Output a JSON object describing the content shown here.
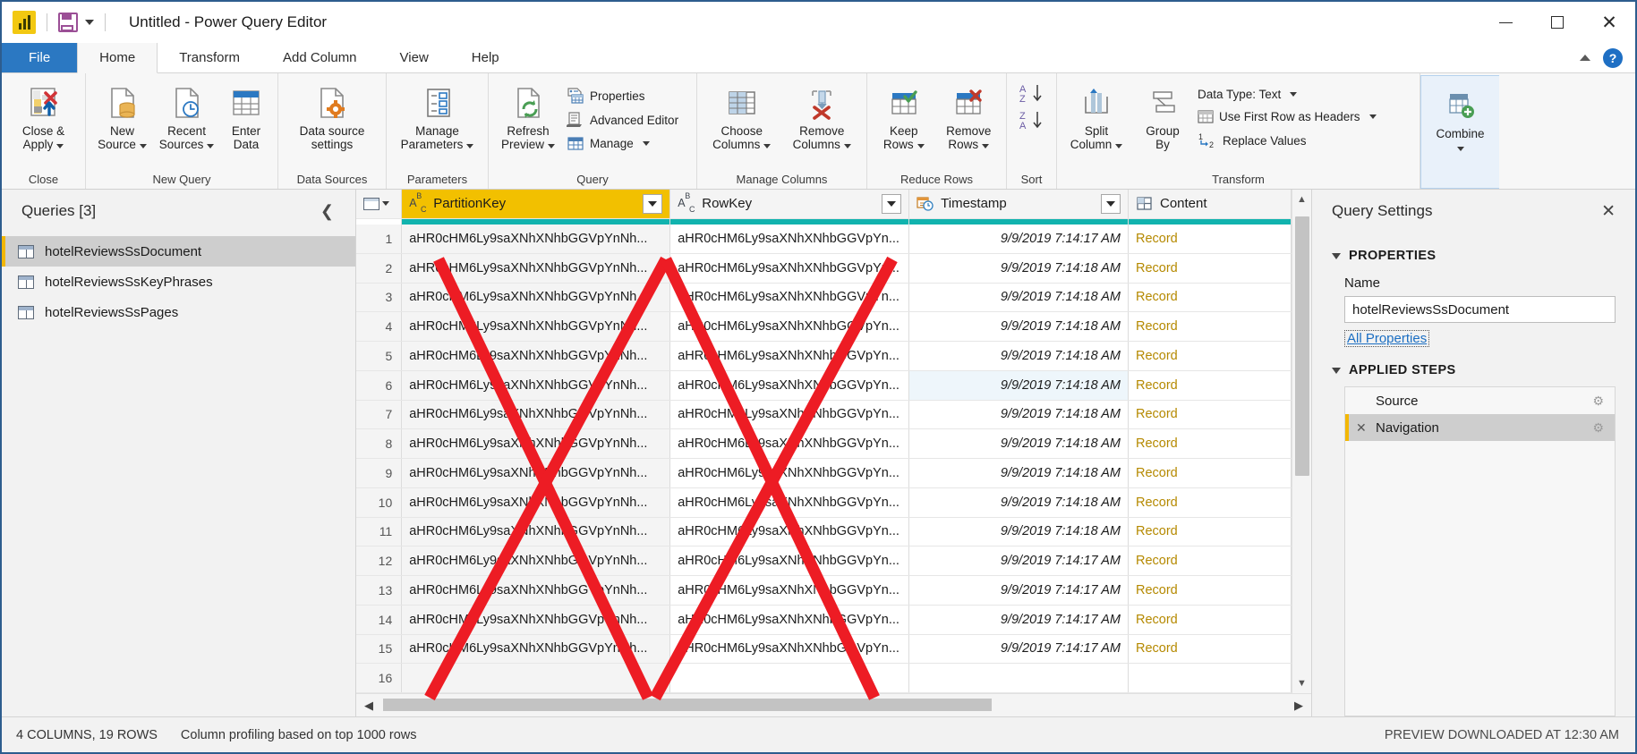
{
  "window": {
    "title": "Untitled - Power Query Editor",
    "logo_icon": "power-bi-logo-icon",
    "save_icon": "save-icon",
    "quick_access_caret": "chevron-down-icon",
    "minimize": "minimize-icon",
    "maximize": "maximize-icon",
    "close": "close-icon"
  },
  "ribbon": {
    "tabs": [
      {
        "label": "File",
        "kind": "file"
      },
      {
        "label": "Home",
        "kind": "active"
      },
      {
        "label": "Transform",
        "kind": "normal"
      },
      {
        "label": "Add Column",
        "kind": "normal"
      },
      {
        "label": "View",
        "kind": "normal"
      },
      {
        "label": "Help",
        "kind": "normal"
      }
    ],
    "collapse_icon": "chevron-up-icon",
    "help_icon": "help-question-icon",
    "help_label": "?",
    "groups": {
      "close": {
        "label": "Close",
        "close_apply_line1": "Close &",
        "close_apply_line2": "Apply"
      },
      "new_query": {
        "label": "New Query",
        "new_source_line1": "New",
        "new_source_line2": "Source",
        "recent_sources_line1": "Recent",
        "recent_sources_line2": "Sources",
        "enter_data_line1": "Enter",
        "enter_data_line2": "Data"
      },
      "data_sources": {
        "label": "Data Sources",
        "data_source_settings_line1": "Data source",
        "data_source_settings_line2": "settings"
      },
      "parameters": {
        "label": "Parameters",
        "manage_parameters_line1": "Manage",
        "manage_parameters_line2": "Parameters"
      },
      "query": {
        "label": "Query",
        "refresh_preview_line1": "Refresh",
        "refresh_preview_line2": "Preview",
        "properties": "Properties",
        "advanced_editor": "Advanced Editor",
        "manage": "Manage"
      },
      "manage_columns": {
        "label": "Manage Columns",
        "choose_columns_line1": "Choose",
        "choose_columns_line2": "Columns",
        "remove_columns_line1": "Remove",
        "remove_columns_line2": "Columns"
      },
      "reduce_rows": {
        "label": "Reduce Rows",
        "keep_rows_line1": "Keep",
        "keep_rows_line2": "Rows",
        "remove_rows_line1": "Remove",
        "remove_rows_line2": "Rows"
      },
      "sort": {
        "label": "Sort",
        "sort_asc_icon": "sort-ascending-icon",
        "sort_desc_icon": "sort-descending-icon"
      },
      "transform": {
        "label": "Transform",
        "split_column_line1": "Split",
        "split_column_line2": "Column",
        "group_by_line1": "Group",
        "group_by_line2": "By",
        "data_type": "Data Type: Text",
        "use_first_row_as_headers": "Use First Row as Headers",
        "replace_values": "Replace Values"
      },
      "combine": {
        "label": "Combine"
      }
    }
  },
  "queries_pane": {
    "title": "Queries [3]",
    "collapse_icon": "chevron-left-icon",
    "items": [
      {
        "label": "hotelReviewsSsDocument",
        "selected": true
      },
      {
        "label": "hotelReviewsSsKeyPhrases",
        "selected": false
      },
      {
        "label": "hotelReviewsSsPages",
        "selected": false
      }
    ]
  },
  "grid": {
    "columns": [
      {
        "name": "PartitionKey",
        "type_icon": "abc-text-icon",
        "highlighted": true,
        "filter_icon": "filter-dropdown-icon"
      },
      {
        "name": "RowKey",
        "type_icon": "abc-text-icon",
        "highlighted": false,
        "filter_icon": "filter-dropdown-icon"
      },
      {
        "name": "Timestamp",
        "type_icon": "datetime-icon",
        "highlighted": false,
        "filter_icon": "filter-dropdown-icon"
      },
      {
        "name": "Content",
        "type_icon": "table-record-icon",
        "highlighted": false,
        "filter_icon": null
      }
    ],
    "select_all_icon": "select-all-table-icon",
    "rows": [
      {
        "n": "1",
        "partitionKey": "aHR0cHM6Ly9saXNhXNhbGGVpYnNh...",
        "rowKey": "aHR0cHM6Ly9saXNhXNhbGGVpYn...",
        "timestamp": "9/9/2019 7:14:17 AM",
        "content": "Record"
      },
      {
        "n": "2",
        "partitionKey": "aHR0cHM6Ly9saXNhXNhbGGVpYnNh...",
        "rowKey": "aHR0cHM6Ly9saXNhXNhbGGVpYn...",
        "timestamp": "9/9/2019 7:14:18 AM",
        "content": "Record"
      },
      {
        "n": "3",
        "partitionKey": "aHR0cHM6Ly9saXNhXNhbGGVpYnNh...",
        "rowKey": "aHR0cHM6Ly9saXNhXNhbGGVpYn...",
        "timestamp": "9/9/2019 7:14:18 AM",
        "content": "Record"
      },
      {
        "n": "4",
        "partitionKey": "aHR0cHM6Ly9saXNhXNhbGGVpYnNh...",
        "rowKey": "aHR0cHM6Ly9saXNhXNhbGGVpYn...",
        "timestamp": "9/9/2019 7:14:18 AM",
        "content": "Record"
      },
      {
        "n": "5",
        "partitionKey": "aHR0cHM6Ly9saXNhXNhbGGVpYnNh...",
        "rowKey": "aHR0cHM6Ly9saXNhXNhbGGVpYn...",
        "timestamp": "9/9/2019 7:14:18 AM",
        "content": "Record"
      },
      {
        "n": "6",
        "partitionKey": "aHR0cHM6Ly9saXNhXNhbGGVpYnNh...",
        "rowKey": "aHR0cHM6Ly9saXNhXNhbGGVpYn...",
        "timestamp": "9/9/2019 7:14:18 AM",
        "content": "Record"
      },
      {
        "n": "7",
        "partitionKey": "aHR0cHM6Ly9saXNhXNhbGGVpYnNh...",
        "rowKey": "aHR0cHM6Ly9saXNhXNhbGGVpYn...",
        "timestamp": "9/9/2019 7:14:18 AM",
        "content": "Record"
      },
      {
        "n": "8",
        "partitionKey": "aHR0cHM6Ly9saXNhXNhbGGVpYnNh...",
        "rowKey": "aHR0cHM6Ly9saXNhXNhbGGVpYn...",
        "timestamp": "9/9/2019 7:14:18 AM",
        "content": "Record"
      },
      {
        "n": "9",
        "partitionKey": "aHR0cHM6Ly9saXNhXNhbGGVpYnNh...",
        "rowKey": "aHR0cHM6Ly9saXNhXNhbGGVpYn...",
        "timestamp": "9/9/2019 7:14:18 AM",
        "content": "Record"
      },
      {
        "n": "10",
        "partitionKey": "aHR0cHM6Ly9saXNhXNhbGGVpYnNh...",
        "rowKey": "aHR0cHM6Ly9saXNhXNhbGGVpYn...",
        "timestamp": "9/9/2019 7:14:18 AM",
        "content": "Record"
      },
      {
        "n": "11",
        "partitionKey": "aHR0cHM6Ly9saXNhXNhbGGVpYnNh...",
        "rowKey": "aHR0cHM6Ly9saXNhXNhbGGVpYn...",
        "timestamp": "9/9/2019 7:14:18 AM",
        "content": "Record"
      },
      {
        "n": "12",
        "partitionKey": "aHR0cHM6Ly9saXNhXNhbGGVpYnNh...",
        "rowKey": "aHR0cHM6Ly9saXNhXNhbGGVpYn...",
        "timestamp": "9/9/2019 7:14:17 AM",
        "content": "Record"
      },
      {
        "n": "13",
        "partitionKey": "aHR0cHM6Ly9saXNhXNhbGGVpYnNh...",
        "rowKey": "aHR0cHM6Ly9saXNhXNhbGGVpYn...",
        "timestamp": "9/9/2019 7:14:17 AM",
        "content": "Record"
      },
      {
        "n": "14",
        "partitionKey": "aHR0cHM6Ly9saXNhXNhbGGVpYnNh...",
        "rowKey": "aHR0cHM6Ly9saXNhXNhbGGVpYn...",
        "timestamp": "9/9/2019 7:14:17 AM",
        "content": "Record"
      },
      {
        "n": "15",
        "partitionKey": "aHR0cHM6Ly9saXNhXNhbGGVpYnNh...",
        "rowKey": "aHR0cHM6Ly9saXNhXNhbGGVpYn...",
        "timestamp": "9/9/2019 7:14:17 AM",
        "content": "Record"
      },
      {
        "n": "16",
        "partitionKey": "",
        "rowKey": "",
        "timestamp": "",
        "content": ""
      }
    ]
  },
  "query_settings": {
    "title": "Query Settings",
    "close_icon": "close-icon",
    "properties_header": "PROPERTIES",
    "name_label": "Name",
    "name_value": "hotelReviewsSsDocument",
    "all_properties_link": "All Properties",
    "applied_steps_header": "APPLIED STEPS",
    "steps": [
      {
        "label": "Source",
        "selected": false,
        "has_delete": false,
        "gear_icon": "gear-icon"
      },
      {
        "label": "Navigation",
        "selected": true,
        "has_delete": true,
        "gear_icon": "gear-icon",
        "delete_icon": "delete-x-icon"
      }
    ]
  },
  "statusbar": {
    "columns_rows": "4 COLUMNS, 19 ROWS",
    "profiling": "Column profiling based on top 1000 rows",
    "preview": "PREVIEW DOWNLOADED AT 12:30 AM"
  },
  "annotation": {
    "type": "red-x-strikethrough-overlay",
    "color": "#ED1C24",
    "description": "Two large red X marks drawn over the PartitionKey/RowKey and Timestamp columns"
  },
  "colors": {
    "file_tab_blue": "#2b78c2",
    "highlight_gold": "#f2c000",
    "profile_teal": "#11b3ae",
    "record_link": "#b58900",
    "annotation_red": "#ED1C24"
  }
}
